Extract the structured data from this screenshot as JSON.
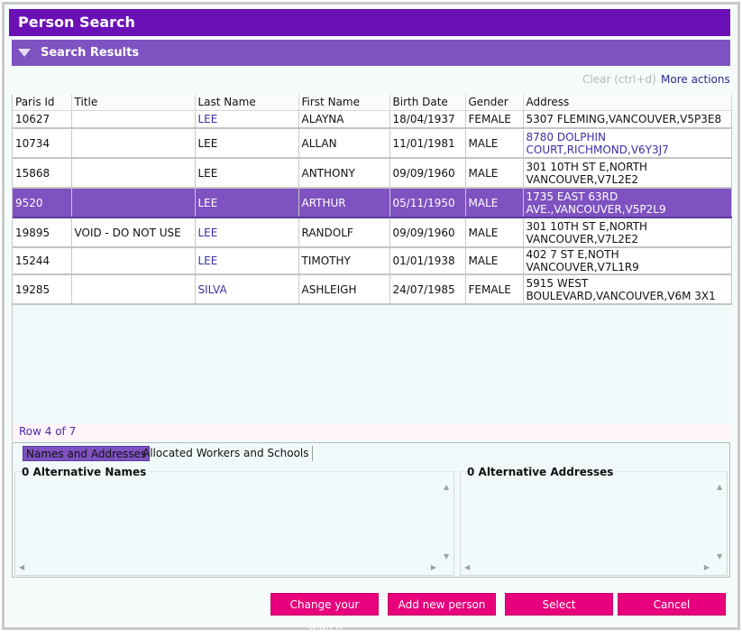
{
  "window": {
    "title": "Person Search",
    "section_title": "Search Results"
  },
  "actions": {
    "clear": "Clear (ctrl+d)",
    "more": "More actions"
  },
  "table": {
    "columns": [
      "Paris Id",
      "Title",
      "Last Name",
      "First Name",
      "Birth Date",
      "Gender",
      "Address"
    ],
    "rows": [
      {
        "id": "10627",
        "title": "",
        "last": "LEE",
        "first": "ALAYNA",
        "dob": "18/04/1937",
        "gender": "FEMALE",
        "address": "5307 FLEMING,VANCOUVER,V5P3E8"
      },
      {
        "id": "10734",
        "title": "",
        "last": "LEE",
        "first": "ALLAN",
        "dob": "11/01/1981",
        "gender": "MALE",
        "address": "8780 DOLPHIN COURT,RICHMOND,V6Y3J7"
      },
      {
        "id": "15868",
        "title": "",
        "last": "LEE",
        "first": "ANTHONY",
        "dob": "09/09/1960",
        "gender": "MALE",
        "address": "301 10TH ST E,NORTH VANCOUVER,V7L2E2"
      },
      {
        "id": "9520",
        "title": "",
        "last": "LEE",
        "first": "ARTHUR",
        "dob": "05/11/1950",
        "gender": "MALE",
        "address": "1735 EAST 63RD AVE.,VANCOUVER,V5P2L9"
      },
      {
        "id": "19895",
        "title": "VOID - DO NOT USE",
        "last": "LEE",
        "first": "RANDOLF",
        "dob": "09/09/1960",
        "gender": "MALE",
        "address": "301 10TH ST E,NORTH VANCOUVER,V7L2E2"
      },
      {
        "id": "15244",
        "title": "",
        "last": "LEE",
        "first": "TIMOTHY",
        "dob": "01/01/1938",
        "gender": "MALE",
        "address": "402 7 ST E,NOTH VANCOUVER,V7L1R9"
      },
      {
        "id": "19285",
        "title": "",
        "last": "SILVA",
        "first": "ASHLEIGH",
        "dob": "24/07/1985",
        "gender": "FEMALE",
        "address": "5915 WEST BOULEVARD,VANCOUVER,V6M 3X1"
      }
    ],
    "row_status": "Row 4 of 7"
  },
  "tabs": {
    "names_addresses": "Names and Addresses",
    "workers_schools": "Allocated Workers and Schools"
  },
  "panels": {
    "alt_names": "0 Alternative Names",
    "alt_addresses": "0 Alternative Addresses"
  },
  "buttons": {
    "change_search": "Change your search",
    "add_person": "Add new person",
    "select": "Select",
    "cancel": "Cancel"
  },
  "colors": {
    "title_bar": "#6b10b6",
    "section_bar": "#7e52c1",
    "selected_row": "#7e52c1",
    "button": "#e8007c"
  }
}
